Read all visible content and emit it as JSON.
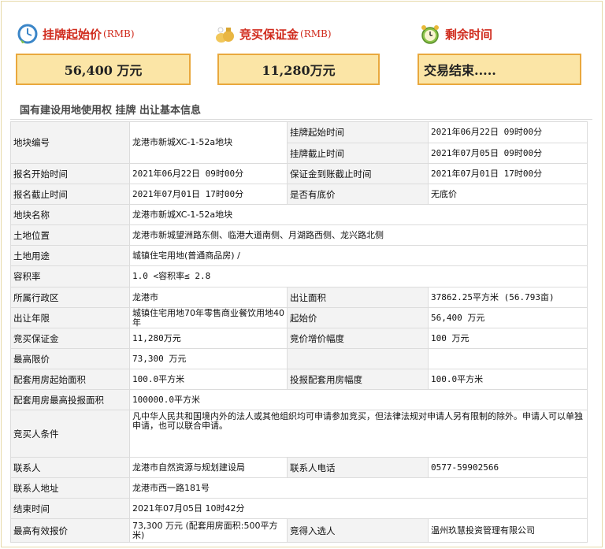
{
  "stats": {
    "start_price": {
      "label": "挂牌起始价",
      "unit": "(RMB)",
      "value": "56,400 万元",
      "icon": "clock-icon"
    },
    "deposit": {
      "label": "竞买保证金",
      "unit": "(RMB)",
      "value": "11,280万元",
      "icon": "money-bag-icon"
    },
    "remaining": {
      "label": "剩余时间",
      "value": "交易结束.....",
      "icon": "alarm-clock-icon"
    }
  },
  "section_title": "国有建设用地使用权 挂牌 出让基本信息",
  "rows": {
    "parcel_no": {
      "label": "地块编号",
      "value": "龙港市新城XC-1-52a地块"
    },
    "list_start": {
      "label": "挂牌起始时间",
      "value": "2021年06月22日 09时00分"
    },
    "list_end": {
      "label": "挂牌截止时间",
      "value": "2021年07月05日 09时00分"
    },
    "reg_start": {
      "label": "报名开始时间",
      "value": "2021年06月22日 09时00分"
    },
    "deposit_deadline": {
      "label": "保证金到账截止时间",
      "value": "2021年07月01日 17时00分"
    },
    "reg_end": {
      "label": "报名截止时间",
      "value": "2021年07月01日 17时00分"
    },
    "reserve": {
      "label": "是否有底价",
      "value": "无底价"
    },
    "parcel_name": {
      "label": "地块名称",
      "value": "龙港市新城XC-1-52a地块"
    },
    "location": {
      "label": "土地位置",
      "value": "龙港市新城望洲路东侧、临港大道南侧、月湖路西侧、龙兴路北侧"
    },
    "use": {
      "label": "土地用途",
      "value": "城镇住宅用地(普通商品房) /"
    },
    "far": {
      "label": "容积率",
      "value": "1.0 <容积率≤ 2.8"
    },
    "district": {
      "label": "所属行政区",
      "value": "龙港市"
    },
    "area": {
      "label": "出让面积",
      "value": "37862.25平方米 (56.793亩)"
    },
    "term": {
      "label": "出让年限",
      "value": "城镇住宅用地70年零售商业餐饮用地40年"
    },
    "start_price": {
      "label": "起始价",
      "value": "56,400 万元"
    },
    "bid_deposit": {
      "label": "竞买保证金",
      "value": "11,280万元"
    },
    "increment": {
      "label": "竞价增价幅度",
      "value": "100 万元"
    },
    "max_price": {
      "label": "最高限价",
      "value": "73,300 万元"
    },
    "housing_start": {
      "label": "配套用房起始面积",
      "value": "100.0平方米"
    },
    "housing_step": {
      "label": "投报配套用房幅度",
      "value": "100.0平方米"
    },
    "housing_max": {
      "label": "配套用房最高投报面积",
      "value": "100000.0平方米"
    },
    "conditions": {
      "label": "竞买人条件",
      "value": "凡中华人民共和国境内外的法人或其他组织均可申请参加竞买，但法律法规对申请人另有限制的除外。申请人可以单独申请，也可以联合申请。"
    },
    "contact": {
      "label": "联系人",
      "value": "龙港市自然资源与规划建设局"
    },
    "phone": {
      "label": "联系人电话",
      "value": "0577-59902566"
    },
    "address": {
      "label": "联系人地址",
      "value": "龙港市西一路181号"
    },
    "end_time": {
      "label": "结束时间",
      "value": "2021年07月05日 10时42分"
    },
    "best_bid": {
      "label": "最高有效报价",
      "value": "73,300 万元 (配套用房面积:500平方米)"
    },
    "winner": {
      "label": "竞得入选人",
      "value": "温州玖慧投资管理有限公司"
    }
  }
}
